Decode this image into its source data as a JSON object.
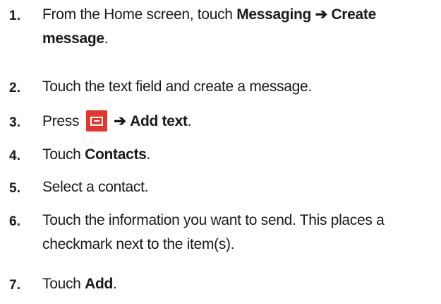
{
  "steps": [
    {
      "number": "1.",
      "text_a": "From the Home screen, touch ",
      "bold_a": "Messaging",
      "arrow": "➔",
      "bold_b": "Create",
      "bold_c": "message",
      "end": "."
    },
    {
      "number": "2.",
      "text": "Touch the text field and create a message."
    },
    {
      "number": "3.",
      "text_a": "Press ",
      "icon": "menu-key-icon",
      "arrow": "➔",
      "bold": "Add text",
      "end": "."
    },
    {
      "number": "4.",
      "text_a": "Touch ",
      "bold": "Contacts",
      "end": "."
    },
    {
      "number": "5.",
      "text": "Select a contact."
    },
    {
      "number": "6.",
      "text_line1": "Touch the information you want to send. This places a",
      "text_line2": "checkmark next to the item(s)."
    },
    {
      "number": "7.",
      "text_a": "Touch ",
      "bold": "Add",
      "end": "."
    }
  ],
  "colors": {
    "menu_key_background": "#e4362b",
    "text": "#1a1a1a"
  }
}
